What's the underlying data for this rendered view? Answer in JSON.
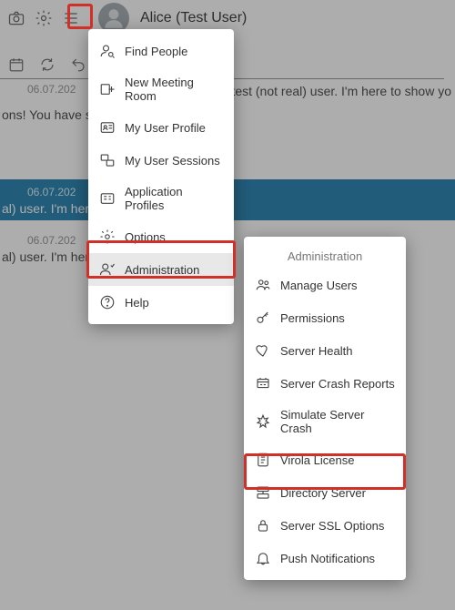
{
  "header": {
    "username": "Alice (Test User)"
  },
  "chat": {
    "line1_date": "06.07.202",
    "line1_text": "test (not real) user. I'm here to show yo",
    "line2": "ons! You have s",
    "sel_date": "06.07.202",
    "sel_text": "al) user. I'm her",
    "line3_date": "06.07.202",
    "line3_text": "al) user. I'm her"
  },
  "menu": {
    "items": [
      {
        "label": "Find People"
      },
      {
        "label": "New Meeting Room"
      },
      {
        "label": "My User Profile"
      },
      {
        "label": "My User Sessions"
      },
      {
        "label": "Application Profiles"
      },
      {
        "label": "Options"
      },
      {
        "label": "Administration"
      },
      {
        "label": "Help"
      }
    ]
  },
  "submenu": {
    "title": "Administration",
    "items": [
      {
        "label": "Manage Users"
      },
      {
        "label": "Permissions"
      },
      {
        "label": "Server Health"
      },
      {
        "label": "Server Crash Reports"
      },
      {
        "label": "Simulate Server Crash"
      },
      {
        "label": "Virola License"
      },
      {
        "label": "Directory Server"
      },
      {
        "label": "Server SSL Options"
      },
      {
        "label": "Push Notifications"
      }
    ]
  }
}
